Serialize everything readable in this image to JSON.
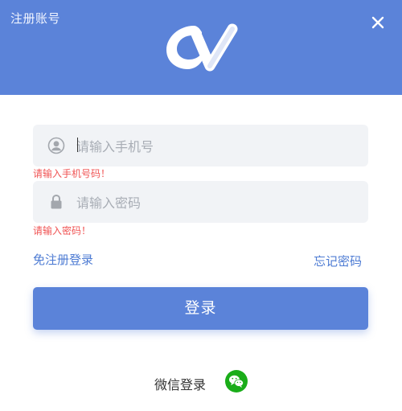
{
  "window": {
    "title": "注册账号",
    "close_icon": "close-icon"
  },
  "brand": {
    "logo_icon": "app-logo",
    "header_color": "#5b83d9"
  },
  "form": {
    "phone_placeholder": "请输入手机号",
    "phone_error": "请输入手机号码！",
    "password_placeholder": "请输入密码",
    "password_error": "请输入密码！",
    "register_link": "免注册登录",
    "forgot_link": "忘记密码",
    "login_button": "登录",
    "error_color": "#f05454"
  },
  "social": {
    "wechat_label": "微信登录",
    "wechat_icon": "wechat-icon",
    "wechat_color": "#1aad19"
  }
}
